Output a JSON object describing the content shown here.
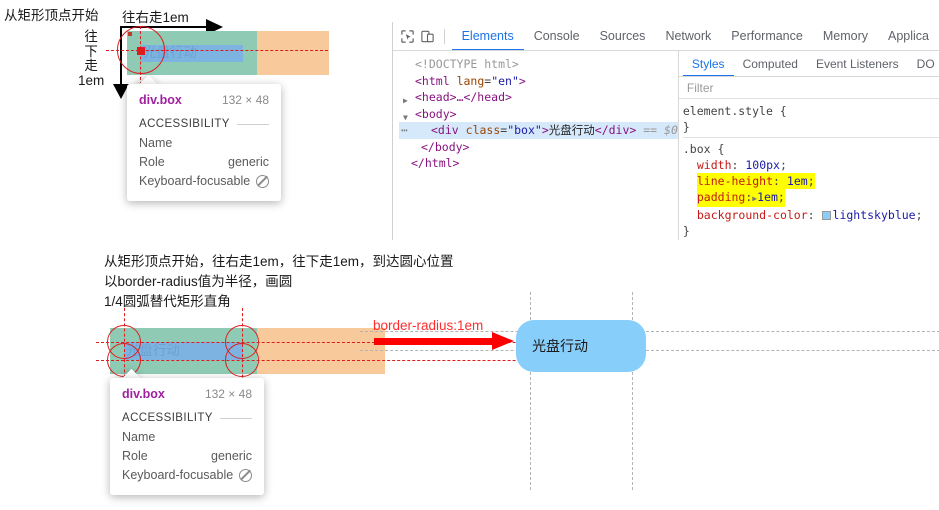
{
  "top_annotation": {
    "start_label": "从矩形顶点开始",
    "right_label": "往右走1em",
    "down_chars": [
      "往",
      "下",
      "走",
      "1em"
    ]
  },
  "box_model_top": {
    "content_text": "光盘行动",
    "margin_color": "#f7c99b",
    "padding_color": "#8fcbb4",
    "content_color": "#7cb3e0",
    "guide_color": "#e01b1b"
  },
  "tooltip": {
    "selector": "div.box",
    "dimensions": "132 × 48",
    "section_label": "ACCESSIBILITY",
    "rows": [
      {
        "label": "Name",
        "value": ""
      },
      {
        "label": "Role",
        "value": "generic"
      },
      {
        "label": "Keyboard-focusable",
        "value": ""
      }
    ]
  },
  "devtools": {
    "toolbar_icons": [
      "inspect-element-icon",
      "device-toolbar-icon"
    ],
    "tabs": [
      {
        "label": "Elements",
        "active": true
      },
      {
        "label": "Console",
        "active": false
      },
      {
        "label": "Sources",
        "active": false
      },
      {
        "label": "Network",
        "active": false
      },
      {
        "label": "Performance",
        "active": false
      },
      {
        "label": "Memory",
        "active": false
      },
      {
        "label": "Applica",
        "active": false
      }
    ],
    "dom": {
      "doctype": "<!DOCTYPE html>",
      "html_open_tag": "<html",
      "html_attr_name": "lang",
      "html_attr_value": "\"en\"",
      "head_line": "<head>…</head>",
      "body_open": "<body>",
      "selected": {
        "open_tag": "<div",
        "attr_name": "class",
        "attr_value": "\"box\"",
        "text": "光盘行动",
        "close_tag": "</div>",
        "console_ref": "== $0"
      },
      "body_close": "</body>",
      "html_close": "</html>"
    },
    "styles": {
      "tabs": [
        {
          "label": "Styles",
          "active": true
        },
        {
          "label": "Computed",
          "active": false
        },
        {
          "label": "Event Listeners",
          "active": false
        },
        {
          "label": "DO",
          "active": false
        }
      ],
      "filter_placeholder": "Filter",
      "element_style": {
        "selector": "element.style {",
        "close": "}"
      },
      "rule": {
        "selector": ".box {",
        "close": "}",
        "declarations": [
          {
            "prop": "width",
            "value": "100px",
            "highlighted": false,
            "expandable": false,
            "swatch": null
          },
          {
            "prop": "line-height",
            "value": "1em",
            "highlighted": true,
            "expandable": false,
            "swatch": null
          },
          {
            "prop": "padding",
            "value": "1em",
            "highlighted": true,
            "expandable": true,
            "swatch": null
          },
          {
            "prop": "background-color",
            "value": "lightskyblue",
            "highlighted": false,
            "expandable": false,
            "swatch": "#87cefa"
          }
        ]
      }
    }
  },
  "lower_annotation": {
    "line1": "从矩形顶点开始，往右走1em，往下走1em，到达圆心位置",
    "line2": "以border-radius值为半径，画圆",
    "line3": "1/4圆弧替代矩形直角"
  },
  "box_model_bottom": {
    "content_text": "光盘行动"
  },
  "border_radius_arrow": {
    "label": "border-radius:1em",
    "color": "#ff0000"
  },
  "rounded_result": {
    "text": "光盘行动",
    "background": "#87cefa",
    "radius": "1em"
  }
}
